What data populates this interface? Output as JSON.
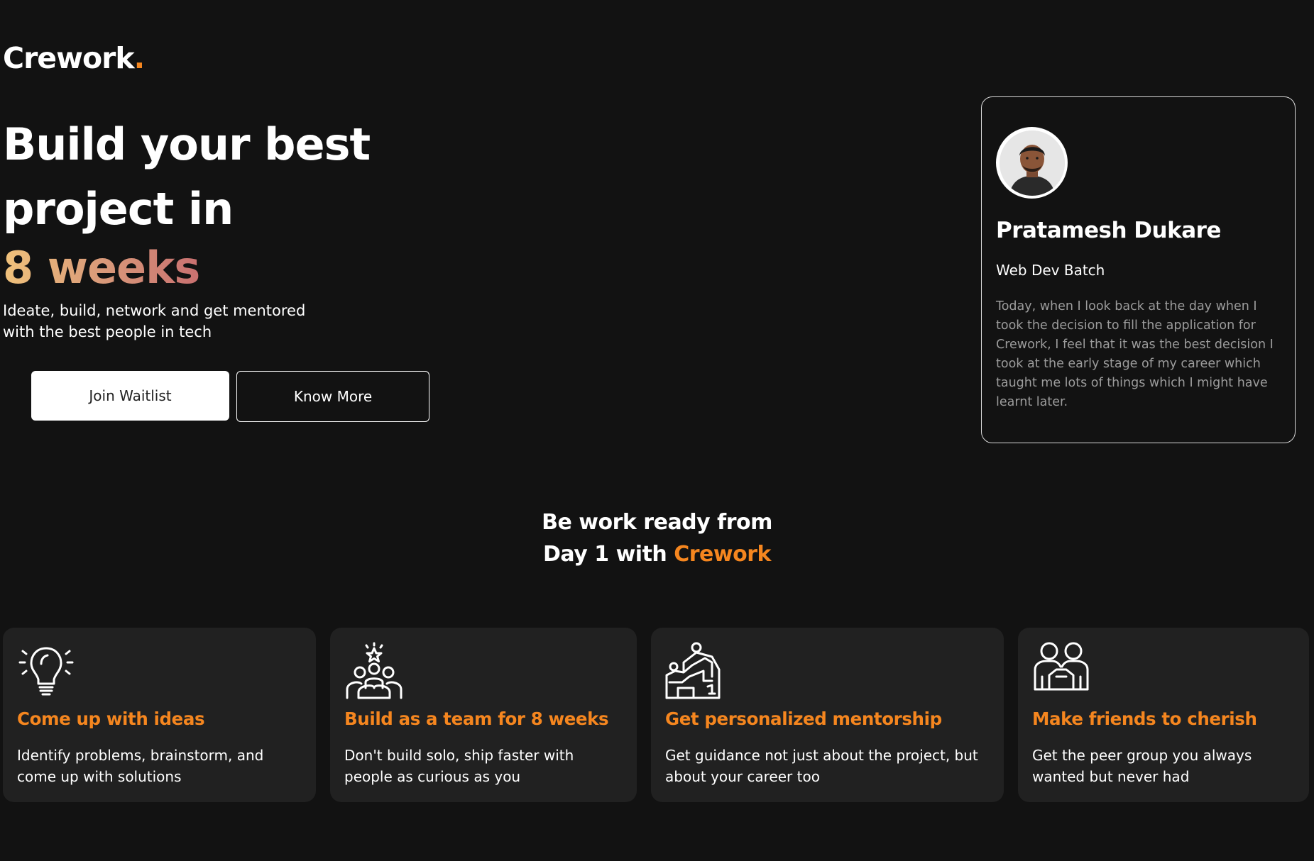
{
  "brand": {
    "name": "Crework",
    "dot": ".",
    "accent_color": "#f5861f"
  },
  "hero": {
    "title_line1": "Build your best",
    "title_line2": "project in",
    "highlight": "8 weeks",
    "subtitle": "Ideate, build, network and get mentored with the best people in tech",
    "primary_button": "Join Waitlist",
    "secondary_button": "Know More"
  },
  "testimonial": {
    "name": "Pratamesh Dukare",
    "batch": "Web Dev Batch",
    "quote": "Today, when I look back at the day when I took the decision to fill the application for Crework, I feel that it was the best decision I took at the early stage of my career which taught me lots of things which I might have learnt later."
  },
  "section": {
    "heading_line1": "Be work ready from",
    "heading_line2_prefix": "Day 1 with ",
    "heading_line2_accent": "Crework"
  },
  "features": [
    {
      "icon": "lightbulb-icon",
      "title": "Come up with ideas",
      "text": "Identify problems, brainstorm, and come up with solutions"
    },
    {
      "icon": "team-star-icon",
      "title": "Build as a team for 8 weeks",
      "text": "Don't build solo, ship faster with people as curious as you"
    },
    {
      "icon": "mentorship-icon",
      "title": "Get personalized mentorship",
      "text": "Get guidance not just about the project, but about your career too"
    },
    {
      "icon": "friends-icon",
      "title": "Make friends to cherish",
      "text": "Get the peer group you always wanted but never had"
    }
  ]
}
